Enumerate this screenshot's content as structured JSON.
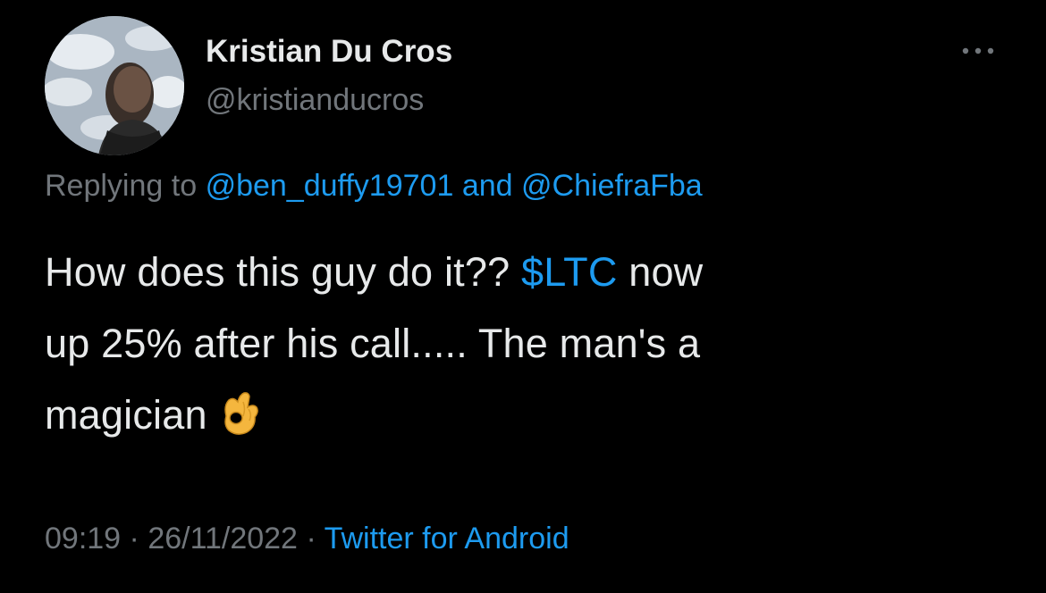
{
  "author": {
    "display_name": "Kristian Du Cros",
    "handle": "@kristianducros"
  },
  "reply_context": {
    "prefix": "Replying to",
    "mention_1": "@ben_duffy19701",
    "joiner": "and",
    "mention_2": "@ChiefraFba"
  },
  "tweet": {
    "line1_pre": "How does this guy do it??",
    "cashtag": "$LTC",
    "line1_post": "now",
    "line2": "up 25% after his call..... The man's a",
    "line3": "magician",
    "emoji": "ok-hand-emoji"
  },
  "meta": {
    "time": "09:19",
    "separator": "·",
    "date": "26/11/2022",
    "source": "Twitter for Android"
  },
  "icons": {
    "more": "more-horizontal-icon"
  },
  "colors": {
    "background": "#000000",
    "primary_text": "#e7e9ea",
    "secondary_text": "#71767b",
    "link": "#1d9bf0"
  }
}
